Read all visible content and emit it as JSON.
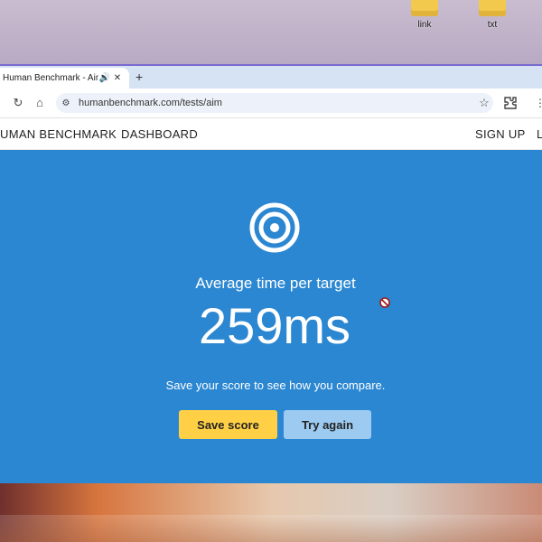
{
  "desktop": {
    "icons": [
      {
        "label": "link"
      },
      {
        "label": "txt"
      }
    ]
  },
  "browser": {
    "tab": {
      "title": "Human Benchmark - Aim",
      "audio_icon": "speaker-icon",
      "close_icon": "close-icon"
    },
    "new_tab_label": "+",
    "toolbar": {
      "url": "humanbenchmark.com/tests/aim"
    }
  },
  "site": {
    "nav": {
      "brand": "UMAN BENCHMARK",
      "dashboard": "DASHBOARD",
      "signup": "SIGN UP",
      "login_partial": "L"
    },
    "result": {
      "subtitle": "Average time per target",
      "score": "259ms",
      "compare_text": "Save your score to see how you compare.",
      "save_button": "Save score",
      "retry_button": "Try again"
    }
  },
  "colors": {
    "hero_background": "#2b87d1",
    "save_button": "#ffd046",
    "retry_button": "#9ccaf0"
  }
}
